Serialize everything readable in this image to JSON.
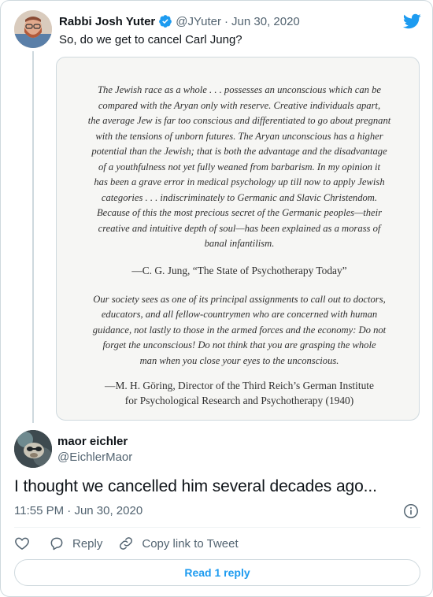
{
  "parent_tweet": {
    "author_name": "Rabbi Josh Yuter",
    "handle": "@JYuter",
    "separator": "·",
    "date": "Jun 30, 2020",
    "text": "So, do we get to cancel Carl Jung?",
    "verified_icon": "verified-badge-icon",
    "quote_image": {
      "paragraph_1_lines": [
        "The Jewish race as a whole . . . possesses an unconscious which can be",
        "compared with the Aryan only with reserve. Creative individuals apart,",
        "the average Jew is far too conscious and differentiated to go about pregnant",
        "with the tensions of unborn futures. The Aryan unconscious has a higher",
        "potential than the Jewish; that is both the advantage and the disadvantage",
        "of a youthfulness not yet fully weaned from barbarism. In my opinion it",
        "has been a grave error in medical psychology up till now to apply Jewish",
        "categories . . . indiscriminately to Germanic and Slavic Christendom.",
        "Because of this the most precious secret of the Germanic peoples—their",
        "creative and intuitive depth of soul—has been explained as a morass of",
        "banal infantilism."
      ],
      "attribution_1": "—C. G. Jung, “The State of Psychotherapy Today”",
      "paragraph_2_lines": [
        "Our society sees as one of its principal assignments to call out to doctors,",
        "educators, and all fellow-countrymen who are concerned with human",
        "guidance, not lastly to those in the armed forces and the economy: Do not",
        "forget the unconscious! Do not think that you are grasping the whole",
        "man when you close your eyes to the unconscious."
      ],
      "attribution_2_lines": [
        "—M. H. Göring, Director of the Third Reich’s German Institute",
        "for Psychological Research and Psychotherapy (1940)"
      ]
    }
  },
  "main_tweet": {
    "author_name": "maor eichler",
    "handle": "@EichlerMaor",
    "text": "I thought we cancelled him several decades ago...",
    "time": "11:55 PM",
    "separator": "·",
    "date": "Jun 30, 2020",
    "actions": {
      "like_label": "",
      "reply_label": "Reply",
      "copy_label": "Copy link to Tweet"
    },
    "read_replies_label": "Read 1 reply"
  },
  "icons": [
    "twitter-logo-icon",
    "verified-badge-icon",
    "info-icon",
    "heart-icon",
    "reply-icon",
    "link-icon"
  ],
  "colors": {
    "accent": "#1d9bf0",
    "text_primary": "#0f1419",
    "text_secondary": "#536471",
    "border": "#cfd9de"
  }
}
